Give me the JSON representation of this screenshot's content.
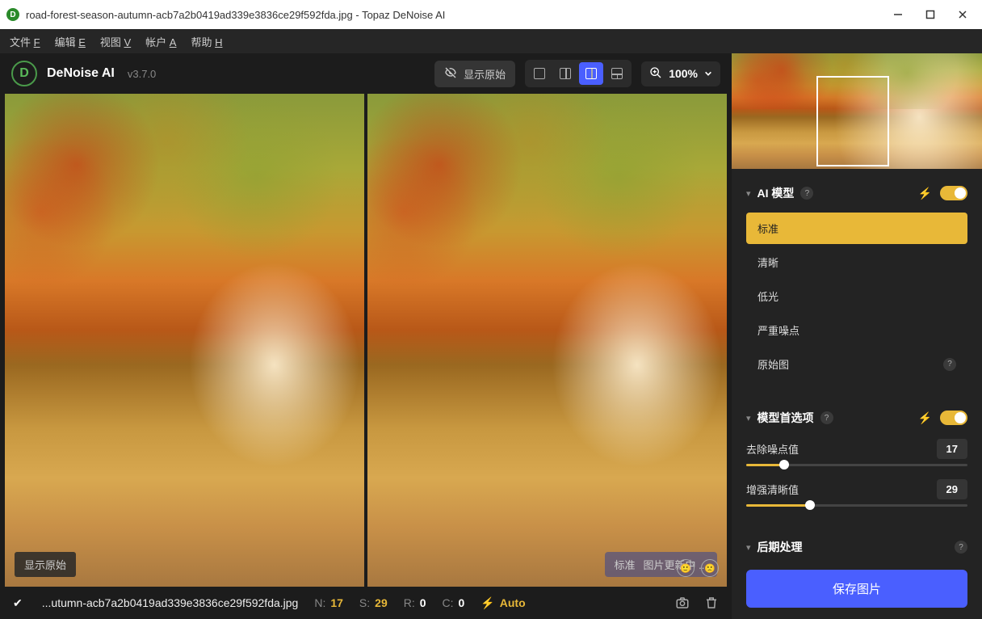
{
  "titlebar": {
    "icon_letter": "D",
    "title": "road-forest-season-autumn-acb7a2b0419ad339e3836ce29f592fda.jpg - Topaz DeNoise AI"
  },
  "menu": {
    "file": "文件 ",
    "file_u": "F",
    "edit": "编辑 ",
    "edit_u": "E",
    "view": "视图 ",
    "view_u": "V",
    "account": "帐户 ",
    "account_u": "A",
    "help": "帮助 ",
    "help_u": "H"
  },
  "toolbar": {
    "logo_letter": "D",
    "app_name": "DeNoise AI",
    "version": "v3.7.0",
    "show_original": "显示原始",
    "zoom": "100%"
  },
  "preview": {
    "left_label": "显示原始",
    "right_model": "标准",
    "right_status": "图片更新中 ..."
  },
  "statusbar": {
    "filename": "...utumn-acb7a2b0419ad339e3836ce29f592fda.jpg",
    "N_label": "N:",
    "N": "17",
    "S_label": "S:",
    "S": "29",
    "R_label": "R:",
    "R": "0",
    "C_label": "C:",
    "C": "0",
    "auto": "Auto"
  },
  "panels": {
    "ai_model": {
      "title": "AI 模型",
      "items": {
        "standard": "标准",
        "clear": "清晰",
        "low_light": "低光",
        "severe": "严重噪点",
        "raw": "原始图"
      }
    },
    "prefs": {
      "title": "模型首选项",
      "denoise_label": "去除噪点值",
      "denoise_value": "17",
      "sharpen_label": "增强清晰值",
      "sharpen_value": "29"
    },
    "post": {
      "title": "后期处理"
    }
  },
  "save_button": "保存图片"
}
